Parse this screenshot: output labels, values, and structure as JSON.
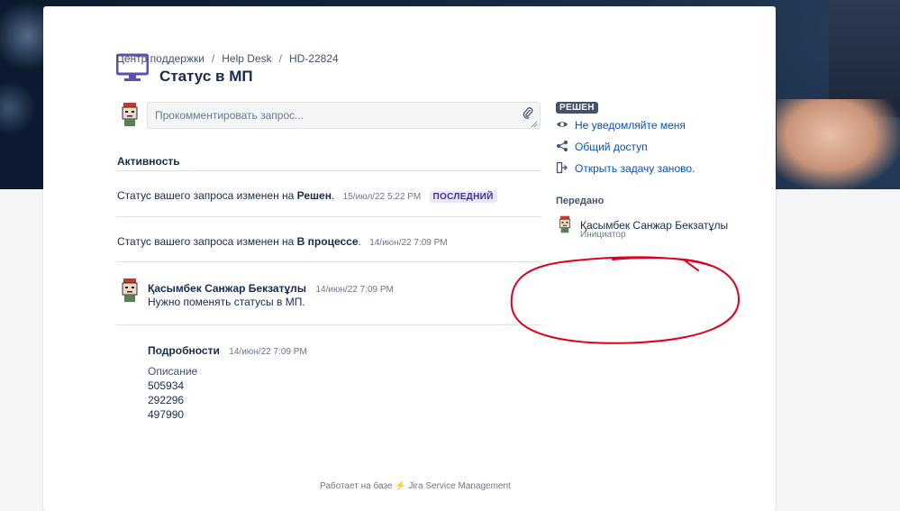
{
  "breadcrumb": {
    "items": [
      "Центр поддержки",
      "Help Desk",
      "HD-22824"
    ],
    "separator": "/"
  },
  "request": {
    "title": "Статус в МП",
    "icon": "monitor-icon"
  },
  "comment": {
    "placeholder": "Прокомментировать запрос..."
  },
  "activity": {
    "heading": "Активность",
    "items": [
      {
        "prefix": "Статус вашего запроса изменен на",
        "status": "Решен",
        "suffix": ".",
        "time": "15/июл/22 5:22 PM",
        "badge": "ПОСЛЕДНИЙ"
      },
      {
        "prefix": "Статус вашего запроса изменен на",
        "status": "В процессе",
        "suffix": ".",
        "time": "14/июн/22 7:09 PM"
      }
    ],
    "comment_entry": {
      "author": "Қасымбек Санжар Бекзатұлы",
      "time": "14/июн/22 7:09 PM",
      "text": "Нужно поменять статусы в МП."
    },
    "details": {
      "heading": "Подробности",
      "time": "14/июн/22 7:09 PM",
      "description_label": "Описание",
      "lines": [
        "505934",
        "292296",
        "497990"
      ]
    }
  },
  "sidebar": {
    "status_badge": "РЕШЕН",
    "links": [
      {
        "label": "Не уведомляйте меня",
        "icon": "eye-icon"
      },
      {
        "label": "Общий доступ",
        "icon": "share-icon"
      },
      {
        "label": "Открыть задачу заново.",
        "icon": "reopen-icon"
      }
    ],
    "shared_heading": "Передано",
    "person": {
      "name": "Қасымбек Санжар Бекзатұлы",
      "role": "Инициатор"
    }
  },
  "footer": {
    "prefix": "Работает на базе",
    "product": "Jira Service Management"
  },
  "colors": {
    "link": "#0052cc",
    "text": "#172b4d",
    "icon_purple": "#5e4db2",
    "annotation_red": "#e0001b"
  }
}
